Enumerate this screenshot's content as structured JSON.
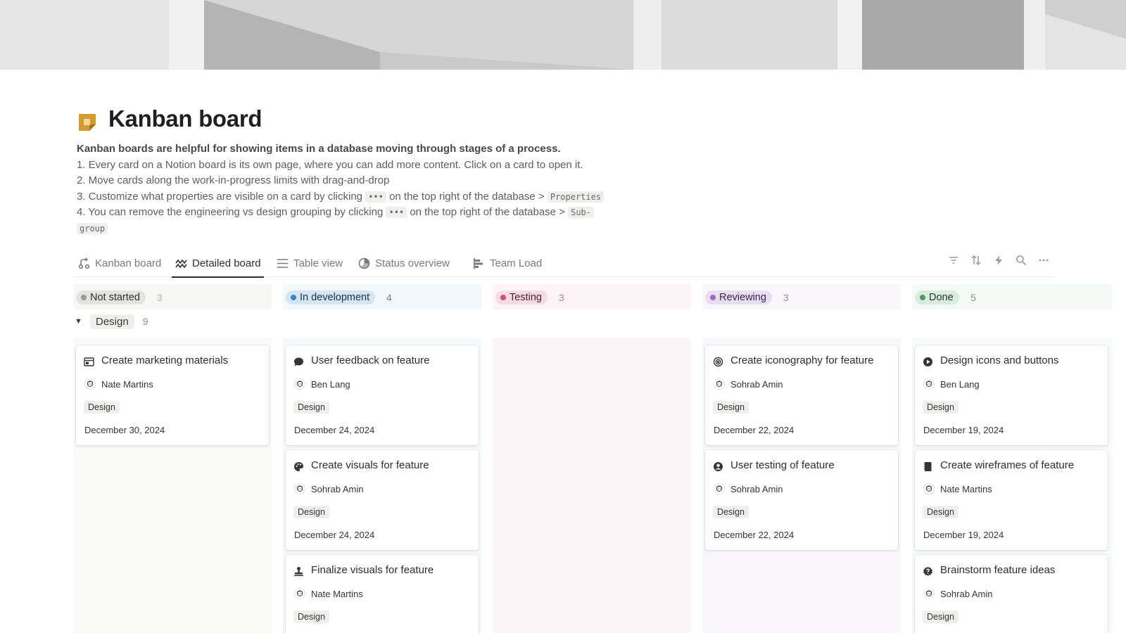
{
  "page": {
    "title": "Kanban board",
    "icon": "sticky-note-icon",
    "description": {
      "bold_line": "Kanban boards are helpful for showing items in a database moving through stages of a process.",
      "line1": "1. Every card on a Notion board is its own page, where you can add more content. Click on a card to open it.",
      "line2": "2. Move cards along the work-in-progress limits with drag-and-drop",
      "line3_a": "3. Customize what properties are visible on a card by clicking",
      "line3_code1": "•••",
      "line3_b": "on the top right of the database",
      "line3_arrow": ">",
      "line3_code2": "Properties",
      "line4_a": "4. You can remove the engineering vs design grouping by clicking",
      "line4_code1": "•••",
      "line4_b": "on the top right of the database",
      "line4_arrow": ">",
      "line4_code2a": "Sub-",
      "line4_code2b": "group"
    }
  },
  "views": [
    {
      "label": "Kanban board",
      "icon": "kanban-icon",
      "active": false
    },
    {
      "label": "Detailed board",
      "icon": "wave-board-icon",
      "active": true
    },
    {
      "label": "Table view",
      "icon": "list-icon",
      "active": false
    },
    {
      "label": "Status overview",
      "icon": "pie-chart-icon",
      "active": false
    },
    {
      "label": "Team Load",
      "icon": "timeline-icon",
      "active": false
    }
  ],
  "toolbar": [
    "filter-icon",
    "sort-icon",
    "automation-icon",
    "search-icon",
    "more-icon"
  ],
  "columns": [
    {
      "status": "Not started",
      "count": "3",
      "color": "#9b9a97",
      "pill_bg": "#e3e3e1",
      "text": "#32302c",
      "head_bg": "#f7f7f5",
      "body_bg": "#f9f9f8",
      "count_color": "#b6b5b2"
    },
    {
      "status": "In development",
      "count": "4",
      "color": "#3a85c9",
      "pill_bg": "#d5e5f3",
      "text": "#183347",
      "head_bg": "#f3f8fc",
      "body_bg": "#f6f9fc",
      "count_color": "#5c8cb5"
    },
    {
      "status": "Testing",
      "count": "3",
      "color": "#d1507b",
      "pill_bg": "#f6dbe4",
      "text": "#4c2337",
      "head_bg": "#fcf4f7",
      "body_bg": "#fcf5f8",
      "count_color": "#c77d96"
    },
    {
      "status": "Reviewing",
      "count": "3",
      "color": "#9d68c9",
      "pill_bg": "#e8def2",
      "text": "#412454",
      "head_bg": "#f9f6fc",
      "body_bg": "#faf7fc",
      "count_color": "#9b86ad"
    },
    {
      "status": "Done",
      "count": "5",
      "color": "#4e9a6a",
      "pill_bg": "#dbecdf",
      "text": "#1c3829",
      "head_bg": "#f5faf6",
      "body_bg": "#f7fbf8",
      "count_color": "#6fa084"
    }
  ],
  "group": {
    "label": "Design",
    "count": "9"
  },
  "cards": [
    {
      "title": "Create marketing materials",
      "icon": "browser-window-icon",
      "person": "Nate Martins",
      "tag": "Design",
      "date": "December 30, 2024"
    },
    {
      "title": "User feedback on feature",
      "icon": "speech-bubble-icon",
      "person": "Ben Lang",
      "tag": "Design",
      "date": "December 24, 2024"
    },
    {
      "title": "Create visuals for feature",
      "icon": "palette-icon",
      "person": "Sohrab Amin",
      "tag": "Design",
      "date": "December 24, 2024"
    },
    {
      "title": "Finalize visuals for feature",
      "icon": "stamp-icon",
      "person": "Nate Martins",
      "tag": "Design",
      "date": ""
    },
    {
      "title": "Create iconography for feature",
      "icon": "target-icon",
      "person": "Sohrab Amin",
      "tag": "Design",
      "date": "December 22, 2024"
    },
    {
      "title": "User testing of feature",
      "icon": "user-circle-icon",
      "person": "Sohrab Amin",
      "tag": "Design",
      "date": "December 22, 2024"
    },
    {
      "title": "Design icons and buttons",
      "icon": "play-circle-icon",
      "person": "Ben Lang",
      "tag": "Design",
      "date": "December 19, 2024"
    },
    {
      "title": "Create wireframes of feature",
      "icon": "notebook-icon",
      "person": "Nate Martins",
      "tag": "Design",
      "date": "December 19, 2024"
    },
    {
      "title": "Brainstorm feature ideas",
      "icon": "question-badge-icon",
      "person": "Sohrab Amin",
      "tag": "Design",
      "date": ""
    }
  ]
}
